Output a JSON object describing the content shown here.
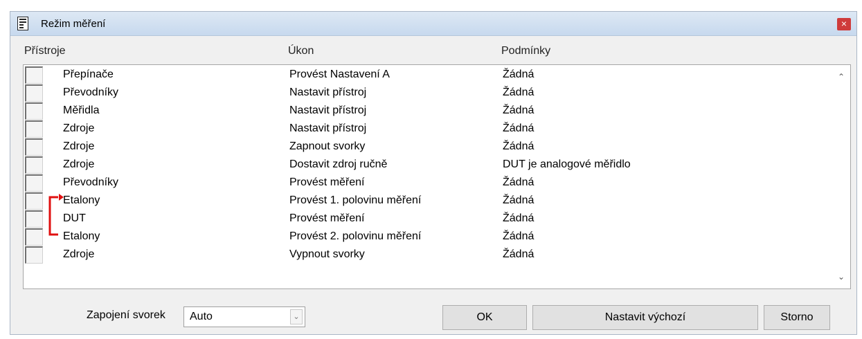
{
  "window": {
    "title": "Režim měření",
    "close_label": "×"
  },
  "columns": {
    "instruments": "Přístroje",
    "action": "Úkon",
    "conditions": "Podmínky"
  },
  "rows": [
    {
      "instrument": "Přepínače",
      "action": "Provést Nastavení A",
      "condition": "Žádná"
    },
    {
      "instrument": "Převodníky",
      "action": "Nastavit přístroj",
      "condition": "Žádná"
    },
    {
      "instrument": "Měřidla",
      "action": "Nastavit přístroj",
      "condition": "Žádná"
    },
    {
      "instrument": "Zdroje",
      "action": "Nastavit přístroj",
      "condition": "Žádná"
    },
    {
      "instrument": "Zdroje",
      "action": "Zapnout svorky",
      "condition": "Žádná"
    },
    {
      "instrument": "Zdroje",
      "action": "Dostavit zdroj ručně",
      "condition": "DUT je analogové měřidlo"
    },
    {
      "instrument": "Převodníky",
      "action": "Provést měření",
      "condition": "Žádná"
    },
    {
      "instrument": "Etalony",
      "action": "Provést 1. polovinu měření",
      "condition": "Žádná"
    },
    {
      "instrument": "DUT",
      "action": "Provést měření",
      "condition": "Žádná"
    },
    {
      "instrument": "Etalony",
      "action": "Provést 2. polovinu měření",
      "condition": "Žádná"
    },
    {
      "instrument": "Zdroje",
      "action": "Vypnout svorky",
      "condition": "Žádná"
    }
  ],
  "bracket": {
    "color": "#e01010",
    "icon": "loop-arrow-icon"
  },
  "terminals": {
    "label": "Zapojení svorek",
    "value": "Auto"
  },
  "buttons": {
    "ok": "OK",
    "set_default": "Nastavit výchozí",
    "cancel": "Storno"
  },
  "colors": {
    "title_bar": "#c7d9ee",
    "close": "#cf3b3b"
  }
}
